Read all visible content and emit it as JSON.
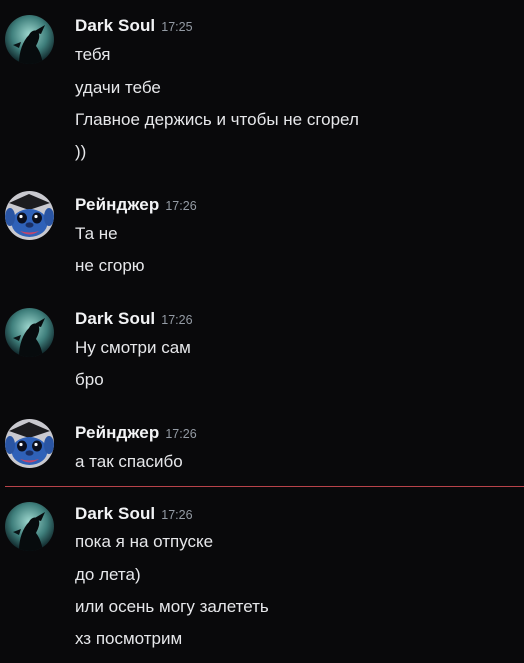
{
  "messages": [
    {
      "author": "Dark Soul",
      "time": "17:25",
      "avatar_icon": "dark-soul-avatar-icon",
      "lines": [
        "тебя",
        "удачи тебе",
        "Главное держись и чтобы не сгорел",
        "))"
      ]
    },
    {
      "author": "Рейнджер",
      "time": "17:26",
      "avatar_icon": "stitch-avatar-icon",
      "lines": [
        "Та не",
        "не сгорю"
      ]
    },
    {
      "author": "Dark Soul",
      "time": "17:26",
      "avatar_icon": "dark-soul-avatar-icon",
      "lines": [
        "Ну смотри сам",
        "бро"
      ]
    },
    {
      "author": "Рейнджер",
      "time": "17:26",
      "avatar_icon": "stitch-avatar-icon",
      "lines": [
        "а так спасибо"
      ]
    },
    {
      "author": "Dark Soul",
      "time": "17:26",
      "avatar_icon": "dark-soul-avatar-icon",
      "lines": [
        "пока я на отпуске",
        "до лета)",
        "или осень могу залететь",
        "хз посмотрим"
      ]
    }
  ],
  "colors": {
    "background": "#09090b",
    "author": "#f2f3f5",
    "text": "#e6e7ea",
    "timestamp": "#949ba4",
    "new_divider": "#b8434a"
  }
}
